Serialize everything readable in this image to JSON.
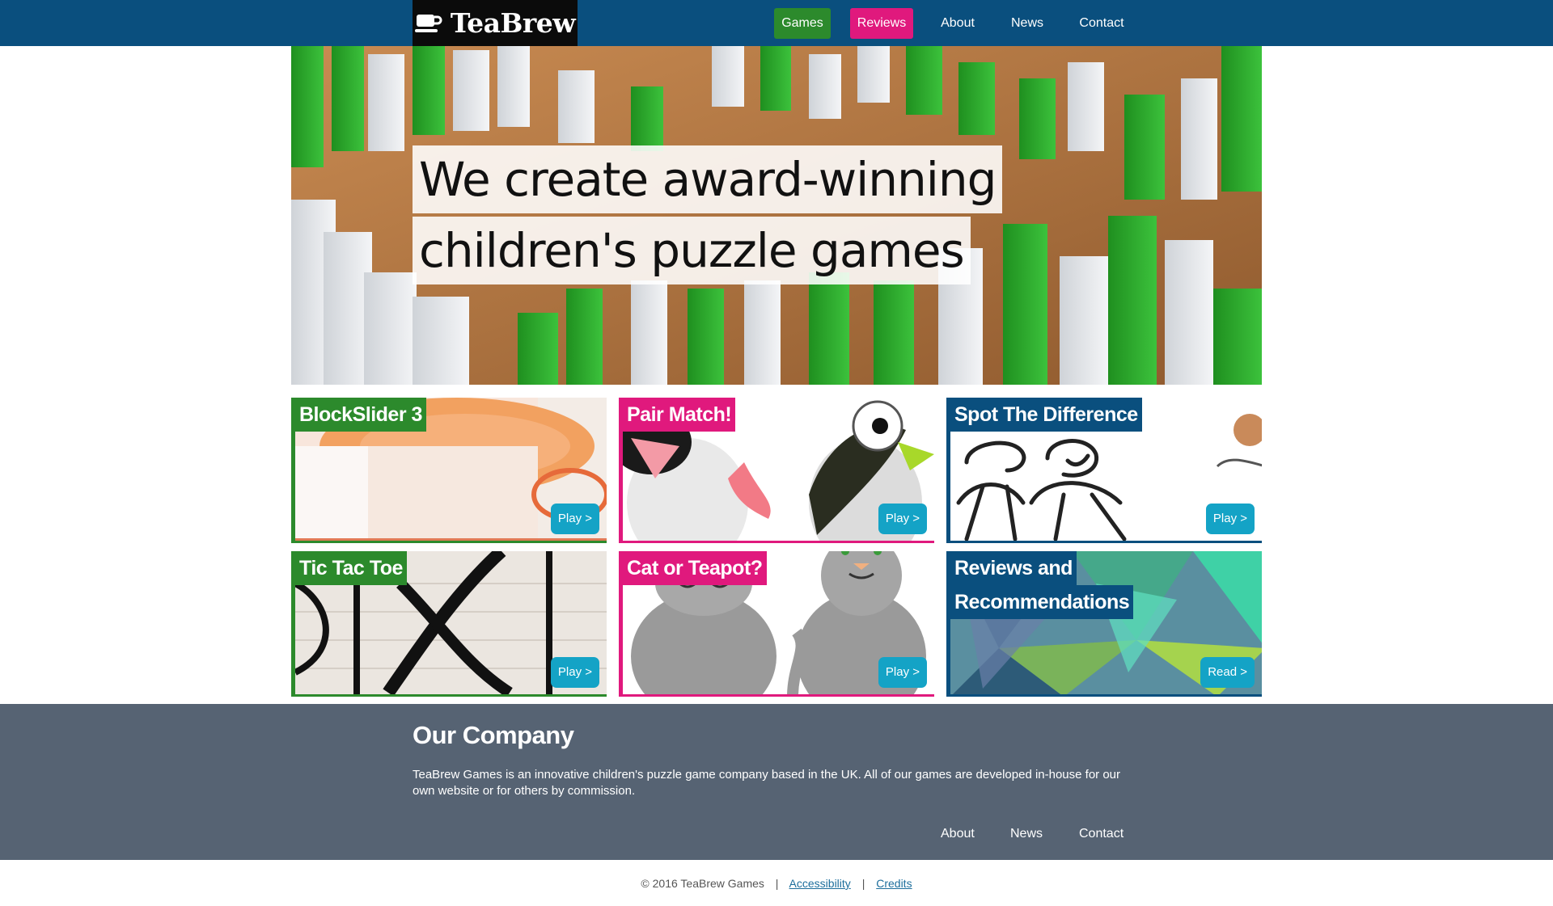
{
  "header": {
    "logo_text": "TeaBrew",
    "logo_icon": "teacup-icon",
    "nav": [
      {
        "label": "Games",
        "color": "#2c8a2c"
      },
      {
        "label": "Reviews",
        "color": "#e0197d"
      },
      {
        "label": "About"
      },
      {
        "label": "News"
      },
      {
        "label": "Contact"
      }
    ]
  },
  "hero": {
    "line1": "We create award-winning",
    "line2": "children's puzzle games"
  },
  "tiles": [
    {
      "title": "BlockSlider 3",
      "button": "Play >",
      "color": "#2c8a2c"
    },
    {
      "title": "Pair Match!",
      "button": "Play >",
      "color": "#e0197d"
    },
    {
      "title": "Spot The Difference",
      "button": "Play >",
      "color": "#0a4f7e"
    },
    {
      "title": "Tic Tac Toe",
      "button": "Play >",
      "color": "#2c8a2c"
    },
    {
      "title": "Cat or Teapot?",
      "button": "Play >",
      "color": "#e0197d"
    },
    {
      "title_line1": "Reviews and",
      "title_line2": "Recommendations",
      "button": "Read >",
      "color": "#0a4f7e"
    }
  ],
  "footer": {
    "heading": "Our Company",
    "text": "TeaBrew Games is an innovative children's puzzle game company based in the UK. All of our games are developed in-house for our own website or for others by commission.",
    "nav": [
      "About",
      "News",
      "Contact"
    ],
    "copyright": "© 2016 TeaBrew Games",
    "links": [
      "Accessibility",
      "Credits"
    ]
  },
  "colors": {
    "header_bg": "#0a4f7e",
    "footer_bg": "#566373",
    "button_bg": "#14a3c6",
    "green": "#2c8a2c",
    "pink": "#e0197d",
    "blue": "#0a4f7e"
  }
}
